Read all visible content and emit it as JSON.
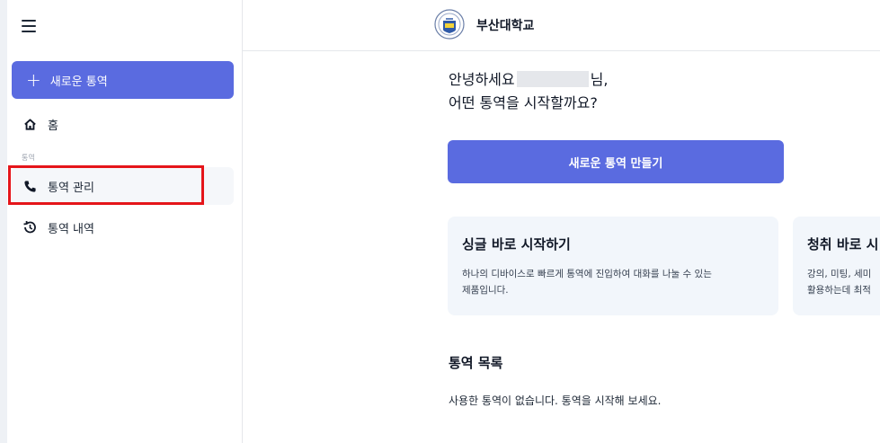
{
  "sidebar": {
    "new_call_label": "새로운 통역",
    "home_label": "홈",
    "section_label": "통역",
    "manage_label": "통역 관리",
    "history_label": "통역 내역"
  },
  "header": {
    "brand": "부산대학교"
  },
  "main": {
    "greeting_prefix": "안녕하세요",
    "greeting_suffix": "님,",
    "greeting_sub": "어떤 통역을 시작할까요?",
    "create_button": "새로운 통역 만들기",
    "cards": [
      {
        "title": "싱글 바로 시작하기",
        "desc_line1": "하나의 디바이스로 빠르게 통역에 진입하여 대화를 나눌 수 있는",
        "desc_line2": "제품입니다."
      },
      {
        "title": "청취 바로 시",
        "desc_line1": "강의, 미팅, 세미",
        "desc_line2": "활용하는데 최적"
      }
    ],
    "list_title": "통역 목록",
    "list_empty": "사용한 통역이 없습니다. 통역을 시작해 보세요."
  },
  "colors": {
    "accent": "#5a6be0",
    "highlight": "#e5151a",
    "card_bg": "#f2f6fb"
  },
  "icons": {
    "menu": "hamburger-icon",
    "plus": "plus-icon",
    "home": "home-icon",
    "phone": "phone-icon",
    "history": "history-icon",
    "logo": "university-logo"
  }
}
